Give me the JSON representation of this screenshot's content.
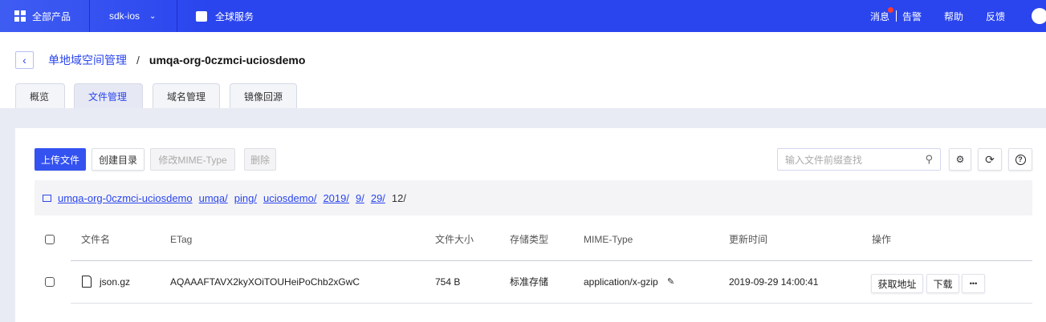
{
  "topbar": {
    "all_products": "全部产品",
    "project": "sdk-ios",
    "global": "全球服务",
    "messages": "消息",
    "alerts": "告警",
    "help": "帮助",
    "feedback": "反馈",
    "accent": "#2a45ee"
  },
  "breadcrumb": {
    "parent": "单地域空间管理",
    "separator": "/",
    "current": "umqa-org-0czmci-uciosdemo"
  },
  "tabs": [
    {
      "label": "概览"
    },
    {
      "label": "文件管理",
      "active": true
    },
    {
      "label": "域名管理"
    },
    {
      "label": "镜像回源"
    }
  ],
  "toolbar": {
    "upload": "上传文件",
    "mkdir": "创建目录",
    "mime": "修改MIME-Type",
    "delete": "删除",
    "search_placeholder": "输入文件前缀查找"
  },
  "path": {
    "segments": [
      "umqa-org-0czmci-uciosdemo",
      "umqa/",
      "ping/",
      "uciosdemo/",
      "2019/",
      "9/",
      "29/"
    ],
    "current": "12/"
  },
  "table": {
    "headers": [
      "文件名",
      "ETag",
      "文件大小",
      "存储类型",
      "MIME-Type",
      "更新时间",
      "操作"
    ],
    "rows": [
      {
        "name": "json.gz",
        "etag": "AQAAAFTAVX2kyXOiTOUHeiPoChb2xGwC",
        "size": "754 B",
        "storage": "标准存储",
        "mime": "application/x-gzip",
        "updated": "2019-09-29 14:00:41",
        "actions": [
          "获取地址",
          "下载",
          "•••"
        ]
      }
    ]
  }
}
